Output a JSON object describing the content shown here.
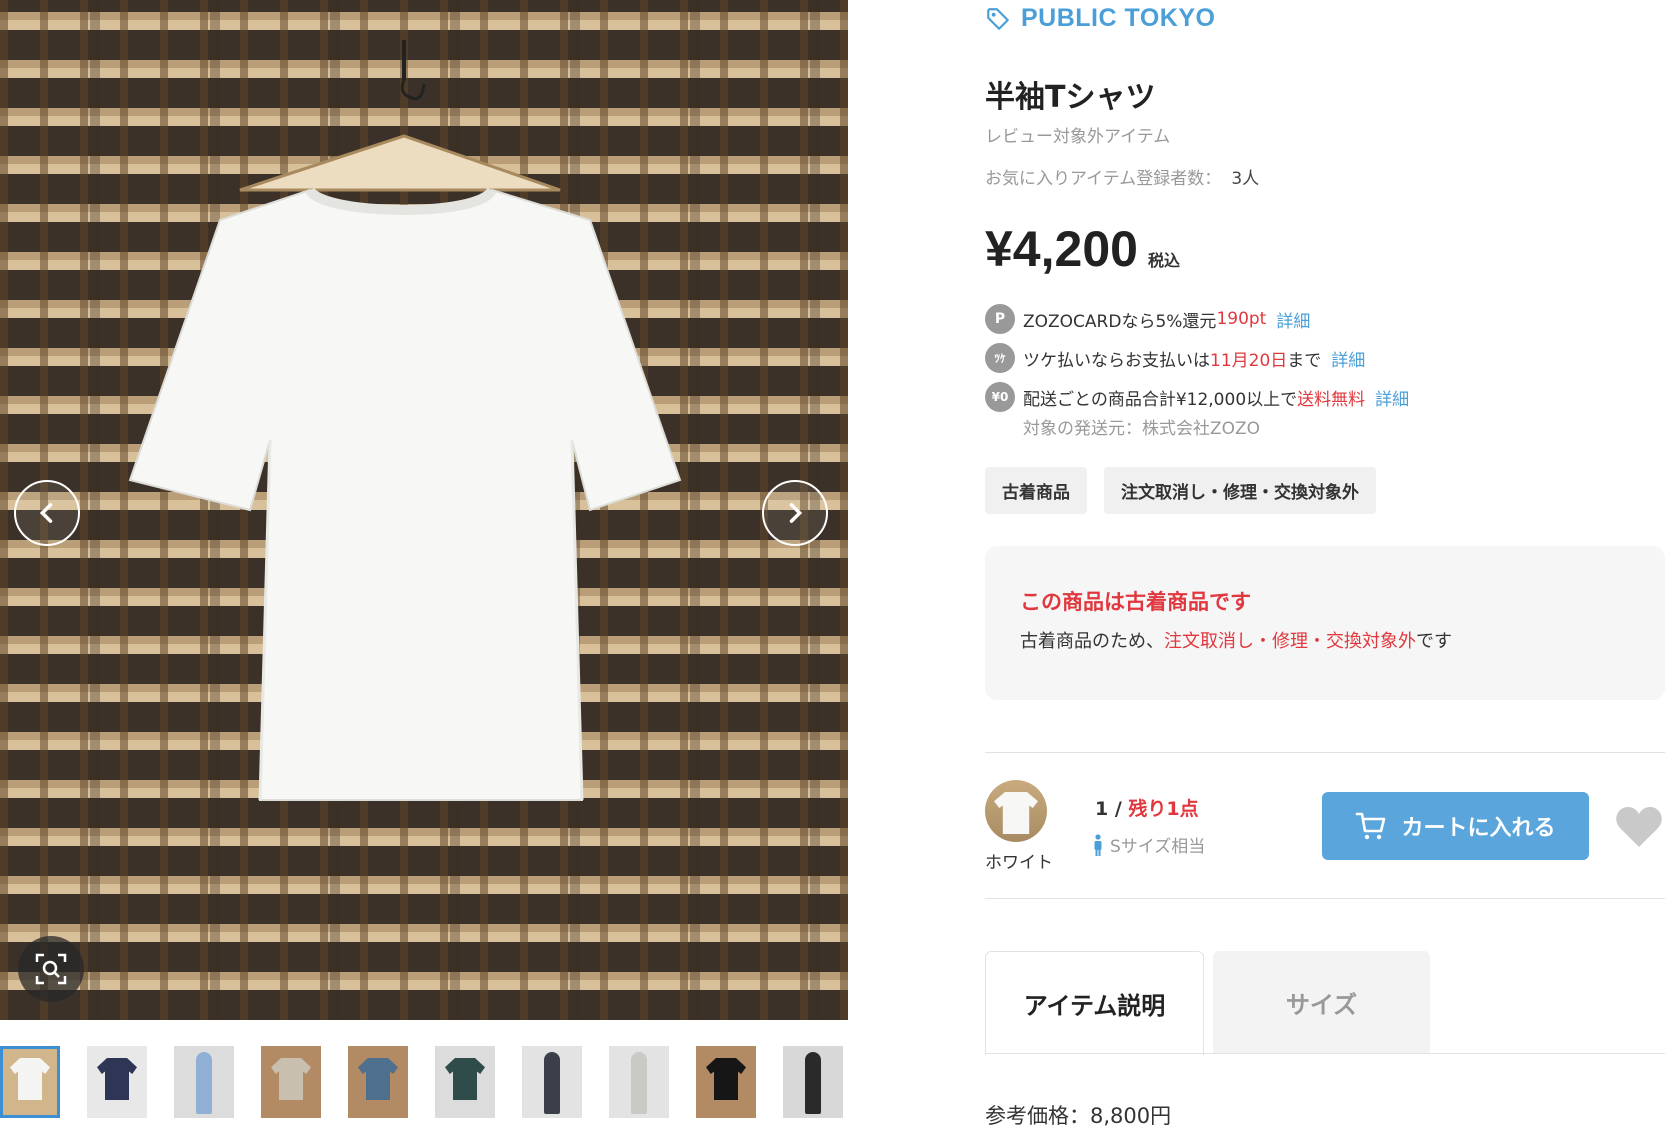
{
  "brand": {
    "name": "PUBLIC TOKYO",
    "icon": "tag-icon"
  },
  "product": {
    "title": "半袖Tシャツ",
    "review_note": "レビュー対象外アイテム",
    "fav_label": "お気に入りアイテム登録者数：",
    "fav_value": "3人",
    "price": "¥4,200",
    "tax_label": "税込"
  },
  "perks": [
    {
      "icon": "P",
      "pre": "ZOZOCARDなら5%還元",
      "highlight": "190pt",
      "post": "",
      "link": "詳細"
    },
    {
      "icon": "ﾂｹ",
      "pre": "ツケ払いならお支払いは",
      "highlight": "11月20日",
      "post": "まで",
      "link": "詳細"
    },
    {
      "icon": "¥0",
      "pre": "配送ごとの商品合計¥12,000以上で",
      "highlight": "送料無料",
      "post": "",
      "link": "詳細"
    }
  ],
  "shipping_origin": "対象の発送元：株式会社ZOZO",
  "tags": [
    "古着商品",
    "注文取消し・修理・交換対象外"
  ],
  "used_notice": {
    "title": "この商品は古着商品です",
    "text_pre": "古着商品のため、",
    "text_highlight": "注文取消し・修理・交換対象外",
    "text_post": "です"
  },
  "variant": {
    "color": "ホワイト",
    "stock_count": "1 /",
    "stock_remaining": "残り1点",
    "size": "Sサイズ相当"
  },
  "cart_button": "カートに入れる",
  "tabs": [
    "アイテム説明",
    "サイズ"
  ],
  "reference_price": "参考価格：8,800円",
  "gallery": {
    "thumbnails": [
      {
        "color": "#f4f4f2",
        "type": "shirt",
        "bg": "#d1b68c"
      },
      {
        "color": "#2f3655",
        "type": "shirt",
        "bg": "#e8e8e8"
      },
      {
        "color": "#8fb0d4",
        "type": "person",
        "bg": "#dcdcdc"
      },
      {
        "color": "#c9bfae",
        "type": "shirt",
        "bg": "#b28a63"
      },
      {
        "color": "#4f6f8f",
        "type": "shirt",
        "bg": "#b28a63"
      },
      {
        "color": "#2f4c4a",
        "type": "shirt",
        "bg": "#dcdcdc"
      },
      {
        "color": "#3a3f4a",
        "type": "person",
        "bg": "#e3e3e3"
      },
      {
        "color": "#c9c9c5",
        "type": "person",
        "bg": "#e3e3e3"
      },
      {
        "color": "#161616",
        "type": "shirt",
        "bg": "#b28a63"
      },
      {
        "color": "#2a2a2a",
        "type": "person",
        "bg": "#d8d8d8"
      }
    ]
  },
  "colors": {
    "accent": "#4a9fd8",
    "red": "#e0383e",
    "cart": "#5aa6dc"
  }
}
